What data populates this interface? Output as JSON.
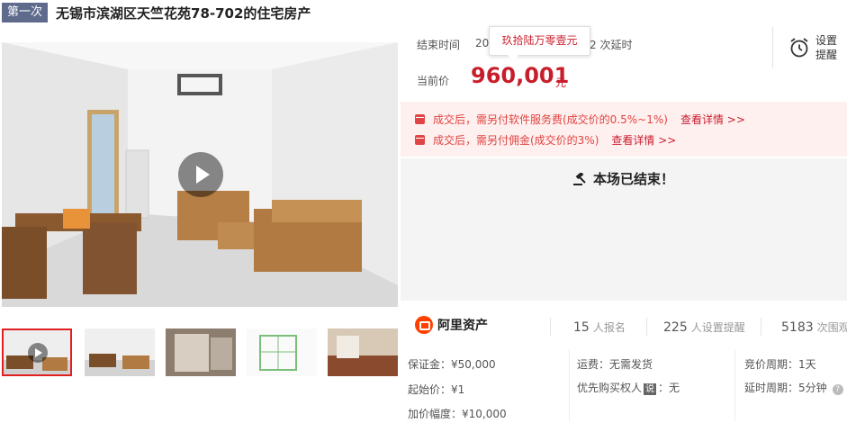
{
  "header": {
    "round_badge": "第一次",
    "title": "无锡市滨湖区天竺花苑78-702的住宅房产"
  },
  "auction": {
    "end_label": "结束时间",
    "end_value": "20",
    "delay_text": "2 次延时",
    "tooltip": "玖拾陆万零壹元",
    "reminder_label": "设置提醒",
    "current_price_label": "当前价",
    "current_price": "960,001",
    "price_unit": "元",
    "fees": [
      {
        "text": "成交后，需另付软件服务费(成交价的0.5%~1%)",
        "detail": "查看详情 >>"
      },
      {
        "text": "成交后，需另付佣金(成交价的3%)",
        "detail": "查看详情 >>"
      }
    ],
    "ended_text": "本场已结束！"
  },
  "stats": {
    "brand": "阿里资产",
    "signups_num": "15",
    "signups_label": "人报名",
    "reminders_num": "225",
    "reminders_label": "人设置提醒",
    "views_num": "5183",
    "views_label": "次围观"
  },
  "details": {
    "deposit": "保证金：¥50,000",
    "start_price": "起始价：¥1",
    "increment": "加价幅度：¥10,000",
    "shipping": "运费：无需发货",
    "priority_label": "优先购买权人",
    "priority_badge": "说",
    "priority_value": "：无",
    "bid_cycle": "竞价周期：1天",
    "extension_cycle": "延时周期：5分钟",
    "help_glyph": "?"
  },
  "colors": {
    "accent_red": "#c81e2c",
    "badge_blue": "#5f6b8d",
    "fee_bg": "#fff0f0"
  }
}
